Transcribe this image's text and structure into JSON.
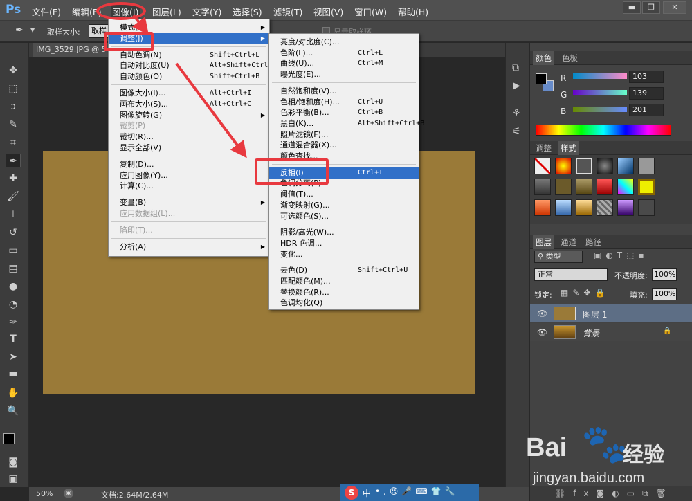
{
  "app": {
    "logo": "Ps"
  },
  "menubar": [
    {
      "label": "文件(F)"
    },
    {
      "label": "编辑(E)"
    },
    {
      "label": "图像(I)"
    },
    {
      "label": "图层(L)"
    },
    {
      "label": "文字(Y)"
    },
    {
      "label": "选择(S)"
    },
    {
      "label": "滤镜(T)"
    },
    {
      "label": "视图(V)"
    },
    {
      "label": "窗口(W)"
    },
    {
      "label": "帮助(H)"
    }
  ],
  "options": {
    "sample_size_label": "取样大小:",
    "sample_value": "取样",
    "show_ring": "显示取样环"
  },
  "document": {
    "tab": "IMG_3529.JPG @ 5",
    "canvas_color": "#9a7a38"
  },
  "status": {
    "zoom": "50%",
    "doc_size": "文档:2.64M/2.64M"
  },
  "image_menu": [
    {
      "label": "模式(M)",
      "sub": true
    },
    {
      "label": "调整(J)",
      "sub": true,
      "highlight": true
    },
    {
      "sep": true
    },
    {
      "label": "自动色调(N)",
      "shortcut": "Shift+Ctrl+L"
    },
    {
      "label": "自动对比度(U)",
      "shortcut": "Alt+Shift+Ctrl+L"
    },
    {
      "label": "自动颜色(O)",
      "shortcut": "Shift+Ctrl+B"
    },
    {
      "sep": true
    },
    {
      "label": "图像大小(I)...",
      "shortcut": "Alt+Ctrl+I"
    },
    {
      "label": "画布大小(S)...",
      "shortcut": "Alt+Ctrl+C"
    },
    {
      "label": "图像旋转(G)",
      "sub": true
    },
    {
      "label": "裁剪(P)",
      "disabled": true
    },
    {
      "label": "裁切(R)..."
    },
    {
      "label": "显示全部(V)"
    },
    {
      "sep": true
    },
    {
      "label": "复制(D)..."
    },
    {
      "label": "应用图像(Y)..."
    },
    {
      "label": "计算(C)..."
    },
    {
      "sep": true
    },
    {
      "label": "变量(B)",
      "sub": true
    },
    {
      "label": "应用数据组(L)...",
      "disabled": true
    },
    {
      "sep": true
    },
    {
      "label": "陷印(T)...",
      "disabled": true
    },
    {
      "sep": true
    },
    {
      "label": "分析(A)",
      "sub": true
    }
  ],
  "adjust_menu": [
    {
      "label": "亮度/对比度(C)..."
    },
    {
      "label": "色阶(L)...",
      "shortcut": "Ctrl+L"
    },
    {
      "label": "曲线(U)...",
      "shortcut": "Ctrl+M"
    },
    {
      "label": "曝光度(E)..."
    },
    {
      "sep": true
    },
    {
      "label": "自然饱和度(V)..."
    },
    {
      "label": "色相/饱和度(H)...",
      "shortcut": "Ctrl+U"
    },
    {
      "label": "色彩平衡(B)...",
      "shortcut": "Ctrl+B"
    },
    {
      "label": "黑白(K)...",
      "shortcut": "Alt+Shift+Ctrl+B"
    },
    {
      "label": "照片滤镜(F)..."
    },
    {
      "label": "通道混合器(X)..."
    },
    {
      "label": "颜色查找..."
    },
    {
      "sep": true
    },
    {
      "label": "反相(I)",
      "shortcut": "Ctrl+I",
      "highlight": true
    },
    {
      "label": "色调分离(P)..."
    },
    {
      "label": "阈值(T)..."
    },
    {
      "label": "渐变映射(G)..."
    },
    {
      "label": "可选颜色(S)..."
    },
    {
      "sep": true
    },
    {
      "label": "阴影/高光(W)..."
    },
    {
      "label": "HDR 色调..."
    },
    {
      "label": "变化..."
    },
    {
      "sep": true
    },
    {
      "label": "去色(D)",
      "shortcut": "Shift+Ctrl+U"
    },
    {
      "label": "匹配颜色(M)..."
    },
    {
      "label": "替换颜色(R)..."
    },
    {
      "label": "色调均化(Q)"
    }
  ],
  "color_panel": {
    "tabs": [
      "颜色",
      "色板"
    ],
    "channels": [
      {
        "label": "R",
        "value": "103"
      },
      {
        "label": "G",
        "value": "139"
      },
      {
        "label": "B",
        "value": "201"
      }
    ],
    "fg": "#000000",
    "bg": "#678bc9"
  },
  "styles_panel": {
    "tabs": [
      "调整",
      "样式"
    ]
  },
  "layers_panel": {
    "tabs": [
      "图层",
      "通道",
      "路径"
    ],
    "filter": "类型",
    "blend": "正常",
    "opacity_label": "不透明度:",
    "opacity": "100%",
    "lock_label": "锁定:",
    "fill_label": "填充:",
    "fill": "100%",
    "layers": [
      {
        "name": "图层 1",
        "selected": true,
        "thumb": "#9a7a38"
      },
      {
        "name": "背景",
        "selected": false,
        "thumb": "#7a5a20"
      }
    ]
  },
  "ime": {
    "label": "中"
  },
  "watermark": {
    "brand": "Bai",
    "brand2": "经验",
    "url": "jingyan.baidu.com"
  }
}
